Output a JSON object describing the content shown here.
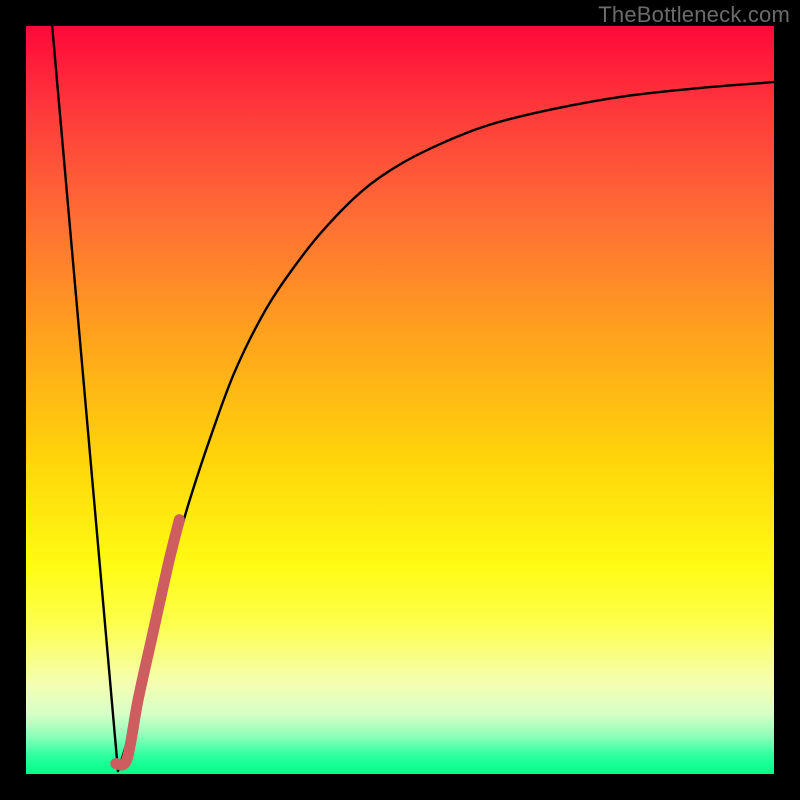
{
  "watermark": "TheBottleneck.com",
  "colors": {
    "frame_border": "#000000",
    "curve": "#000000",
    "highlight": "#cd5d5f"
  },
  "chart_data": {
    "type": "line",
    "title": "",
    "xlabel": "",
    "ylabel": "",
    "xlim": [
      0,
      100
    ],
    "ylim": [
      0,
      100
    ],
    "grid": false,
    "series": [
      {
        "name": "left-descent",
        "x": [
          3.5,
          12.3
        ],
        "y": [
          100,
          0.4
        ]
      },
      {
        "name": "right-curve",
        "x": [
          12.3,
          14,
          16,
          18,
          20,
          22,
          25,
          28,
          32,
          36,
          40,
          45,
          50,
          56,
          62,
          70,
          80,
          90,
          100
        ],
        "y": [
          0.4,
          6,
          14,
          22,
          30,
          37,
          46,
          54,
          62,
          68,
          73,
          78,
          81.5,
          84.5,
          86.8,
          88.8,
          90.6,
          91.7,
          92.5
        ]
      },
      {
        "name": "highlight-segment",
        "x": [
          12.0,
          13.5,
          15.0,
          17.0,
          19.0,
          20.5
        ],
        "y": [
          1.4,
          2.0,
          10.0,
          19.0,
          28.0,
          34.0
        ]
      }
    ]
  }
}
